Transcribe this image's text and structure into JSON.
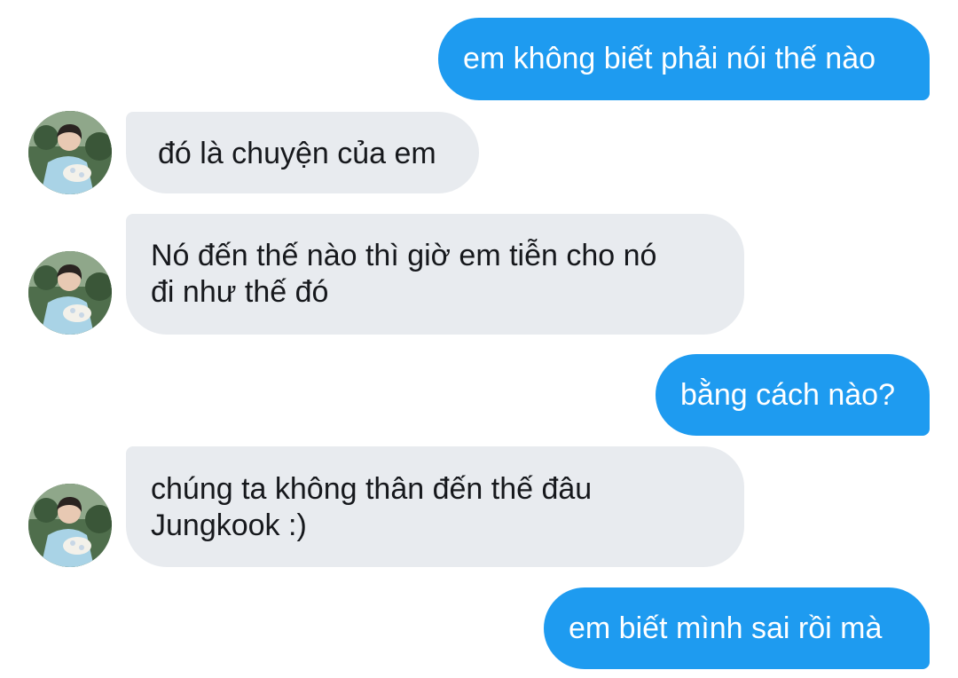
{
  "conversation": {
    "messages": [
      {
        "direction": "sent",
        "text": "em không biết phải nói thế nào"
      },
      {
        "direction": "received",
        "text": "đó là chuyện của em"
      },
      {
        "direction": "received",
        "lines": [
          "Nó đến thế nào thì giờ em tiễn cho nó",
          "đi như thế đó"
        ]
      },
      {
        "direction": "sent",
        "text": "bằng cách nào?"
      },
      {
        "direction": "received",
        "lines": [
          "chúng ta không thân đến thế đâu",
          "Jungkook :)"
        ]
      },
      {
        "direction": "sent",
        "text": "em biết mình sai rồi mà"
      }
    ]
  },
  "colors": {
    "sent_bubble": "#1e9bf0",
    "received_bubble": "#e8ebef",
    "sent_text": "#ffffff",
    "received_text": "#16181c"
  },
  "icons": {
    "contact_avatar": "avatar-photo"
  }
}
